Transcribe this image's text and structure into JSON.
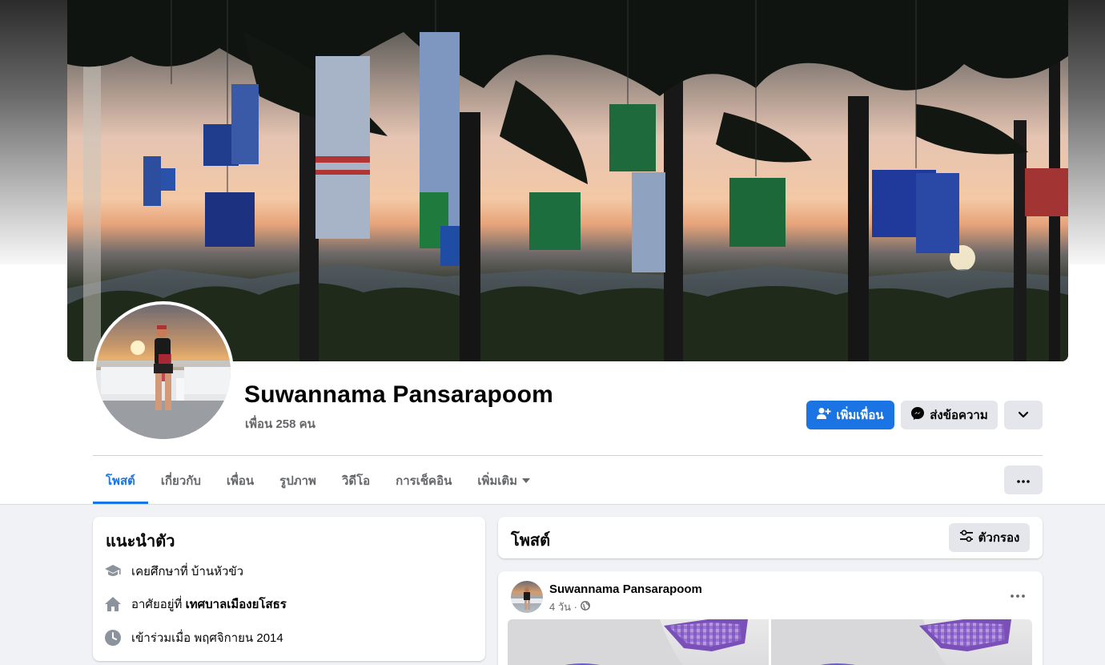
{
  "profile": {
    "name": "Suwannama Pansarapoom",
    "friends": "เพื่อน 258 คน"
  },
  "actions": {
    "add_friend": "เพิ่มเพื่อน",
    "message": "ส่งข้อความ"
  },
  "tabs": [
    {
      "label": "โพสต์",
      "active": true
    },
    {
      "label": "เกี่ยวกับ",
      "active": false
    },
    {
      "label": "เพื่อน",
      "active": false
    },
    {
      "label": "รูปภาพ",
      "active": false
    },
    {
      "label": "วิดีโอ",
      "active": false
    },
    {
      "label": "การเช็คอิน",
      "active": false
    },
    {
      "label": "เพิ่มเติม",
      "active": false
    }
  ],
  "intro": {
    "title": "แนะนำตัว",
    "education_prefix": "เคยศึกษาที่ บ้านหัวขัว",
    "lives_prefix": "อาศัยอยู่ที่",
    "lives_place": "เทศบาลเมืองยโสธร",
    "joined": "เข้าร่วมเมื่อ พฤศจิกายน 2014"
  },
  "posts_header": {
    "title": "โพสต์",
    "filter_label": "ตัวกรอง"
  },
  "post": {
    "author": "Suwannama Pansarapoom",
    "time": "4 วัน ·"
  },
  "colors": {
    "accent": "#1b74e4",
    "secondary_button": "#e4e6eb",
    "page_bg": "#f0f2f5"
  }
}
